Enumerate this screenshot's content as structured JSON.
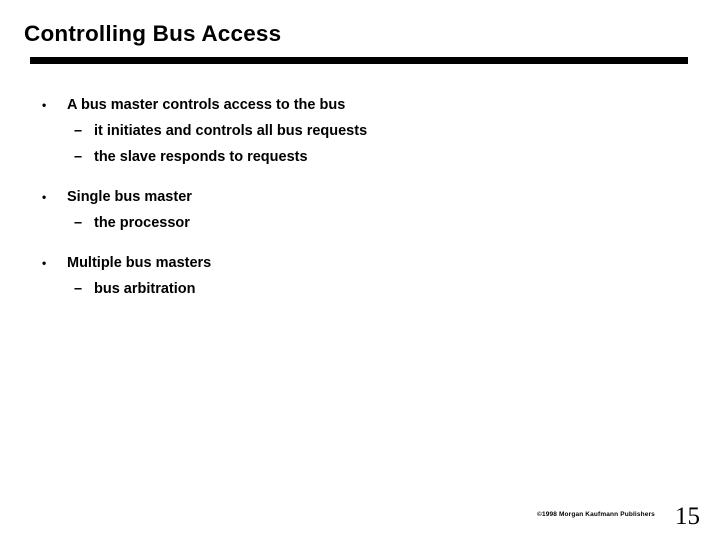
{
  "slide": {
    "title": "Controlling Bus Access",
    "background_color": "#ffffff",
    "text_color": "#000000",
    "rule_color": "#000000"
  },
  "content": {
    "groups": [
      {
        "bullet_marker": "•",
        "text": "A bus master controls access to the bus",
        "sub_marker": "–",
        "subitems": [
          "it initiates and controls all bus requests",
          "the slave responds to requests"
        ]
      },
      {
        "bullet_marker": "•",
        "text": "Single bus master",
        "sub_marker": "–",
        "subitems": [
          "the processor"
        ]
      },
      {
        "bullet_marker": "•",
        "text": "Multiple bus masters",
        "sub_marker": "–",
        "subitems": [
          "bus arbitration"
        ]
      }
    ]
  },
  "footer": {
    "copyright": "©1998 Morgan Kaufmann Publishers",
    "page_number": "15"
  }
}
